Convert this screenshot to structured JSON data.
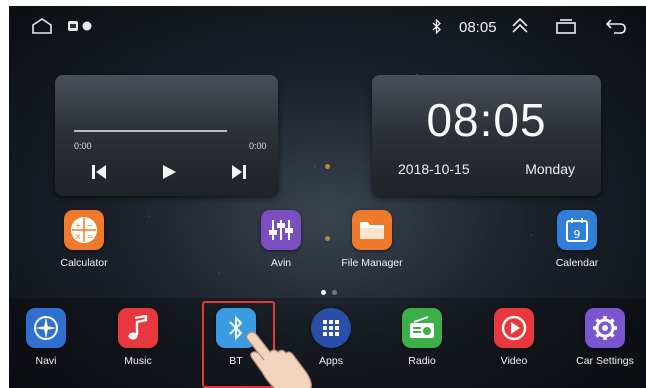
{
  "status_bar": {
    "icons": [
      "home-outline-icon",
      "notification-icon",
      "bluetooth-icon",
      "expand-up-icon",
      "recent-apps-icon",
      "back-icon"
    ],
    "time": "08:05"
  },
  "music_widget": {
    "elapsed": "0:00",
    "duration": "0:00",
    "progress": 0,
    "controls": [
      "previous-icon",
      "play-icon",
      "next-icon"
    ]
  },
  "clock_widget": {
    "time": "08:05",
    "date": "2018-10-15",
    "day": "Monday"
  },
  "page_indicator": {
    "pages": 2,
    "current": 1
  },
  "home_apps": [
    {
      "label": "Calculator",
      "icon": "calculator-icon",
      "color": "#f07a2c"
    },
    {
      "label": "Avin",
      "icon": "equalizer-icon",
      "color": "#7b4fc0"
    },
    {
      "label": "File Manager",
      "icon": "folder-icon",
      "color": "#f07a2c"
    },
    {
      "label": "Calendar",
      "icon": "calendar-icon",
      "color": "#2f7ed8"
    }
  ],
  "dock_apps": [
    {
      "label": "Navi",
      "icon": "compass-icon",
      "color": "#2f6fd0"
    },
    {
      "label": "Music",
      "icon": "music-note-icon",
      "color": "#e8383d"
    },
    {
      "label": "BT",
      "icon": "bluetooth-icon",
      "color": "#3a9be0"
    },
    {
      "label": "Apps",
      "icon": "apps-grid-icon",
      "color": "#2b4fa8"
    },
    {
      "label": "Radio",
      "icon": "radio-icon",
      "color": "#3cae4a"
    },
    {
      "label": "Video",
      "icon": "play-circle-icon",
      "color": "#e8383d"
    },
    {
      "label": "Car Settings",
      "icon": "gear-icon",
      "color": "#7a55d0"
    }
  ],
  "highlight_color": "#e03a3a"
}
